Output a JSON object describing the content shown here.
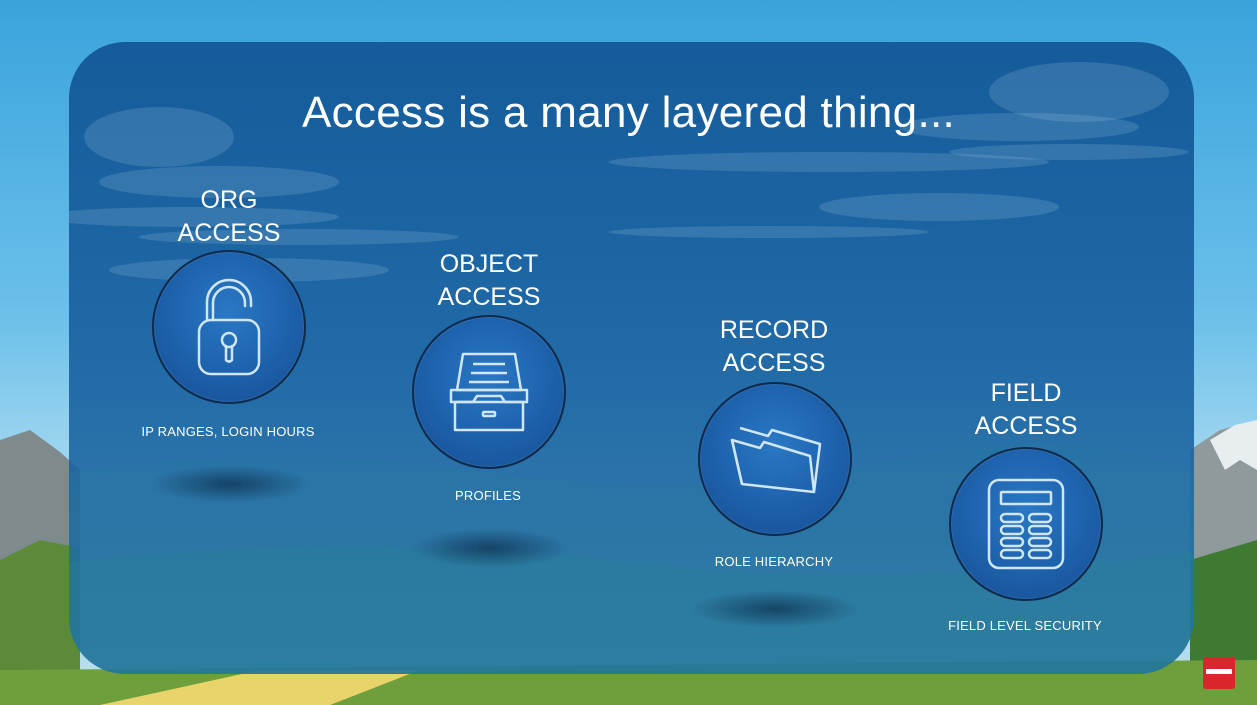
{
  "slide": {
    "title": "Access is a many layered thing...",
    "sections": [
      {
        "heading": [
          "ORG",
          "ACCESS"
        ],
        "caption": "IP RANGES, LOGIN HOURS",
        "icon": "unlocked-padlock-icon"
      },
      {
        "heading": [
          "OBJECT",
          "ACCESS"
        ],
        "caption": "PROFILES",
        "icon": "file-drawer-icon"
      },
      {
        "heading": [
          "RECORD",
          "ACCESS"
        ],
        "caption": "ROLE HIERARCHY",
        "icon": "open-folder-icon"
      },
      {
        "heading": [
          "FIELD",
          "ACCESS"
        ],
        "caption": "FIELD LEVEL SECURITY",
        "icon": "form-fields-icon"
      }
    ]
  },
  "colors": {
    "panel": "#155a98",
    "circle": "#1c5ea8",
    "circle_border": "#0e2a4a",
    "text": "#ffffff",
    "sky": "#3aa3dc",
    "youtube_red": "#d9252b"
  }
}
